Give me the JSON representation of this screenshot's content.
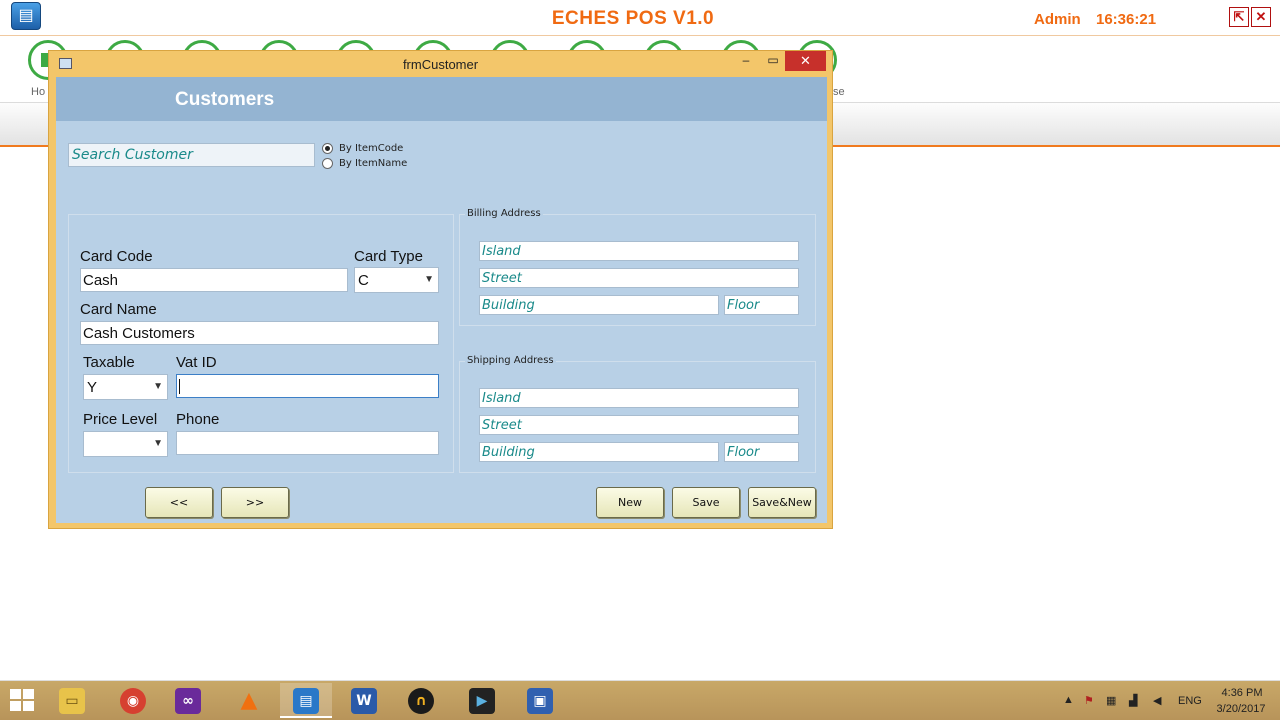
{
  "app": {
    "title": "ECHES POS V1.0",
    "user": "Admin",
    "clock": "16:36:21",
    "toolbar_label_left": "Ho",
    "toolbar_label_right": "se"
  },
  "dialog": {
    "window_title": "frmCustomer",
    "min_glyph": "–",
    "max_glyph": "▭",
    "close_glyph": "✕",
    "header": "Customers",
    "search": {
      "placeholder": "Search Customer",
      "value": ""
    },
    "search_options": [
      {
        "label": "By ItemCode",
        "selected": true
      },
      {
        "label": "By ItemName",
        "selected": false
      }
    ],
    "fields": {
      "card_code_label": "Card Code",
      "card_code_value": "Cash",
      "card_type_label": "Card Type",
      "card_type_value": "C",
      "card_name_label": "Card Name",
      "card_name_value": "Cash Customers",
      "taxable_label": "Taxable",
      "taxable_value": "Y",
      "vat_id_label": "Vat ID",
      "vat_id_value": "",
      "price_level_label": "Price Level",
      "price_level_value": "",
      "phone_label": "Phone",
      "phone_value": ""
    },
    "billing": {
      "caption": "Billing Address",
      "island": "Island",
      "street": "Street",
      "building": "Building",
      "floor": "Floor"
    },
    "shipping": {
      "caption": "Shipping Address",
      "island": "Island",
      "street": "Street",
      "building": "Building",
      "floor": "Floor"
    },
    "buttons": {
      "prev": "<<",
      "next": ">>",
      "new": "New",
      "save": "Save",
      "save_new": "Save&New"
    }
  },
  "taskbar": {
    "apps": [
      "file-explorer",
      "chrome",
      "visual-studio",
      "vlc",
      "eches-pos",
      "word",
      "audio-app",
      "app-dark",
      "remote-app"
    ],
    "word_glyph": "W",
    "language": "ENG",
    "time": "4:36 PM",
    "date": "3/20/2017"
  },
  "colors": {
    "accent_orange": "#f06a12",
    "window_border": "#f3c66a",
    "client_bg": "#b8d0e6",
    "header_band": "#94b4d2",
    "hint_text": "#1a8a8a",
    "toolbar_circle": "#3eaa44"
  }
}
